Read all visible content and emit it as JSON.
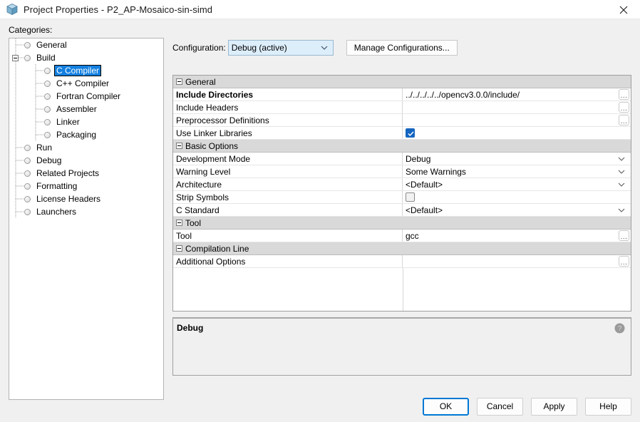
{
  "window": {
    "title": "Project Properties - P2_AP-Mosaico-sin-simd",
    "icon": "project-cube-icon",
    "close_label": "✕"
  },
  "categories": {
    "label": "Categories:",
    "items": [
      {
        "label": "General",
        "depth": 0,
        "node": "leaf",
        "selected": false
      },
      {
        "label": "Build",
        "depth": 0,
        "node": "expanded",
        "selected": false
      },
      {
        "label": "C Compiler",
        "depth": 1,
        "node": "leaf",
        "selected": true
      },
      {
        "label": "C++ Compiler",
        "depth": 1,
        "node": "leaf",
        "selected": false
      },
      {
        "label": "Fortran Compiler",
        "depth": 1,
        "node": "leaf",
        "selected": false
      },
      {
        "label": "Assembler",
        "depth": 1,
        "node": "leaf",
        "selected": false
      },
      {
        "label": "Linker",
        "depth": 1,
        "node": "leaf",
        "selected": false
      },
      {
        "label": "Packaging",
        "depth": 1,
        "node": "leaf",
        "selected": false
      },
      {
        "label": "Run",
        "depth": 0,
        "node": "leaf",
        "selected": false
      },
      {
        "label": "Debug",
        "depth": 0,
        "node": "leaf",
        "selected": false
      },
      {
        "label": "Related Projects",
        "depth": 0,
        "node": "leaf",
        "selected": false
      },
      {
        "label": "Formatting",
        "depth": 0,
        "node": "leaf",
        "selected": false
      },
      {
        "label": "License Headers",
        "depth": 0,
        "node": "leaf",
        "selected": false
      },
      {
        "label": "Launchers",
        "depth": 0,
        "node": "leaf",
        "selected": false
      }
    ]
  },
  "configuration": {
    "label": "Configuration:",
    "selected": "Debug (active)",
    "options": [
      "Debug (active)"
    ],
    "manage_button": "Manage Configurations..."
  },
  "property_grid": {
    "rows": [
      {
        "kind": "section",
        "name": "General"
      },
      {
        "kind": "text",
        "name": "Include Directories",
        "value": "../../../../../opencv3.0.0/include/",
        "bold": true,
        "editor": "ellipsis"
      },
      {
        "kind": "text",
        "name": "Include Headers",
        "value": "",
        "bold": false,
        "editor": "ellipsis"
      },
      {
        "kind": "text",
        "name": "Preprocessor Definitions",
        "value": "",
        "bold": false,
        "editor": "ellipsis"
      },
      {
        "kind": "checkbox",
        "name": "Use Linker Libraries",
        "value": "",
        "bold": false,
        "checked": true
      },
      {
        "kind": "section",
        "name": "Basic Options"
      },
      {
        "kind": "combo",
        "name": "Development Mode",
        "value": "Debug",
        "bold": false
      },
      {
        "kind": "combo",
        "name": "Warning Level",
        "value": "Some Warnings",
        "bold": false
      },
      {
        "kind": "combo",
        "name": "Architecture",
        "value": "<Default>",
        "bold": false
      },
      {
        "kind": "checkbox",
        "name": "Strip Symbols",
        "value": "",
        "bold": false,
        "checked": false
      },
      {
        "kind": "combo",
        "name": "C Standard",
        "value": "<Default>",
        "bold": false
      },
      {
        "kind": "section",
        "name": "Tool"
      },
      {
        "kind": "text",
        "name": "Tool",
        "value": "gcc",
        "bold": false,
        "editor": "ellipsis"
      },
      {
        "kind": "section",
        "name": "Compilation Line"
      },
      {
        "kind": "text",
        "name": "Additional Options",
        "value": "",
        "bold": false,
        "editor": "ellipsis"
      }
    ]
  },
  "description": {
    "title": "Debug",
    "body": "",
    "help_icon": "help-question-icon"
  },
  "footer": {
    "buttons": [
      {
        "label": "OK",
        "primary": true
      },
      {
        "label": "Cancel",
        "primary": false
      },
      {
        "label": "Apply",
        "primary": false
      },
      {
        "label": "Help",
        "primary": false
      }
    ]
  },
  "colors": {
    "selection_blue": "#1380e0",
    "focus_blue": "#0078d4",
    "checkbox_blue": "#1565c0",
    "section_gray": "#d9d9d9",
    "dialog_bg": "#f0f0f0"
  }
}
